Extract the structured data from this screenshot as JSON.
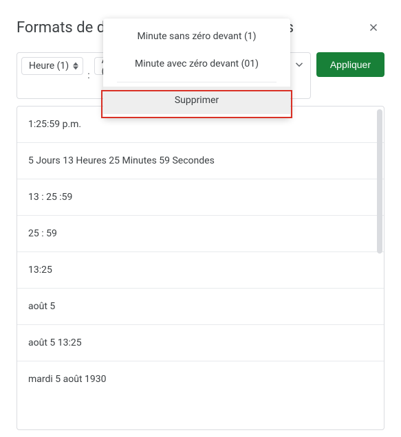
{
  "dialog": {
    "title": "Formats de date et d'heure personnalisés"
  },
  "chips": {
    "hour": "Heure (1)",
    "sep1": ":",
    "ampm": "AM/PM (p.m.)"
  },
  "apply_label": "Appliquer",
  "dropdown": {
    "opt1": "Minute sans zéro devant (1)",
    "opt2": "Minute avec zéro devant (01)",
    "delete": "Supprimer"
  },
  "formats": {
    "items": [
      {
        "label": "1:25:59 p.m."
      },
      {
        "label": "5 Jours 13 Heures 25 Minutes 59 Secondes"
      },
      {
        "label": "13 : 25 :59"
      },
      {
        "label": "25 : 59"
      },
      {
        "label": "13:25"
      },
      {
        "label": "août 5"
      },
      {
        "label": "août 5 13:25"
      },
      {
        "label": "mardi 5 août 1930"
      }
    ]
  }
}
